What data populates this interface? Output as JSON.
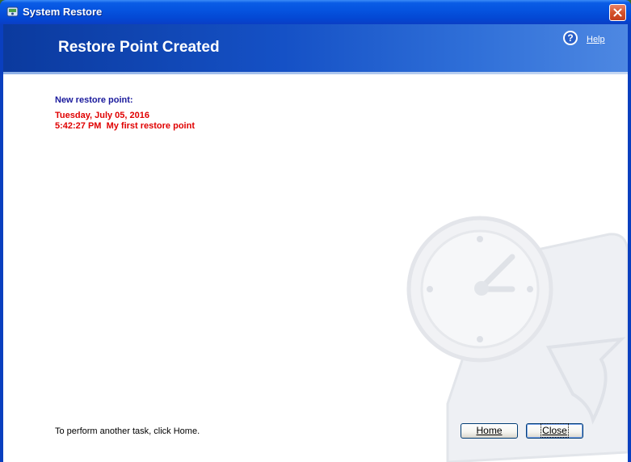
{
  "window": {
    "title": "System Restore"
  },
  "header": {
    "title": "Restore Point Created",
    "help_label": "Help"
  },
  "content": {
    "new_restore_label": "New restore point:",
    "restore_date": "Tuesday, July 05, 2016",
    "restore_time_and_name": "5:42:27 PM  My first restore point"
  },
  "footer": {
    "instruction": "To perform another task, click Home.",
    "home_label": "Home",
    "close_label": "Close"
  },
  "icons": {
    "title": "system-restore-icon",
    "close": "close-icon",
    "help": "help-icon",
    "watermark": "clock-restore-watermark"
  },
  "colors": {
    "title_bar": "#0552de",
    "header_band": "#1551c6",
    "restore_text": "#e00000",
    "label_text": "#1a1a9c"
  }
}
